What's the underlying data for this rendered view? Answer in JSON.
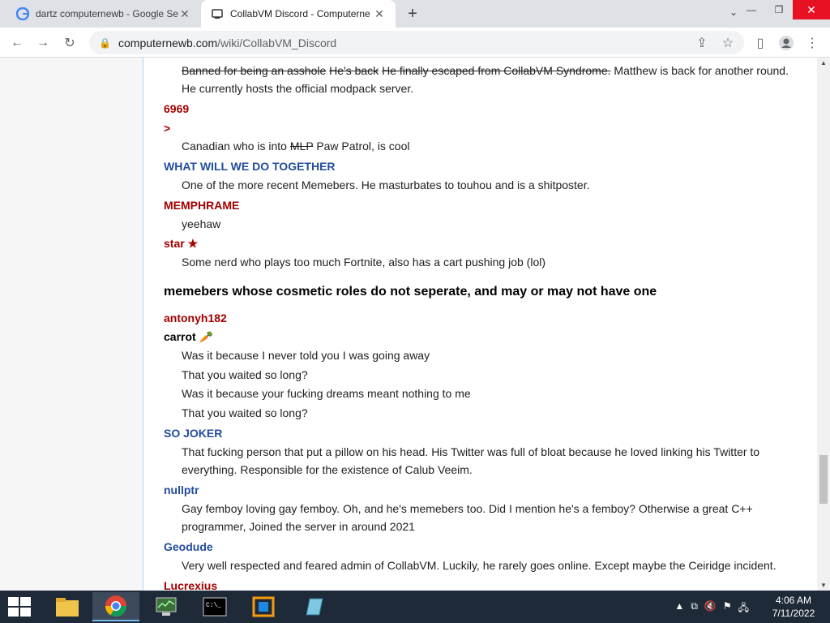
{
  "browser": {
    "tabs": [
      {
        "title": "dartz computernewb - Google Se",
        "favicon": "google-g-icon"
      },
      {
        "title": "CollabVM Discord - Computerne",
        "favicon": "computernewb-icon"
      }
    ],
    "url_host": "computernewb.com",
    "url_path": "/wiki/CollabVM_Discord"
  },
  "page": {
    "top_strike_1": "Banned for being an asshole",
    "top_strike_2": "He's back",
    "top_strike_3": "He finally escaped from CollabVM Syndrome.",
    "top_normal": "Matthew is back for another round.",
    "top_line2": "He currently hosts the official modpack server.",
    "n_6969": "6969",
    "n_gt": ">",
    "canadian_a": "Canadian who is into",
    "canadian_strike": "MLP",
    "canadian_b": "Paw Patrol, is cool",
    "n_together": "WHAT WILL WE DO TOGETHER",
    "t_together": "One of the more recent Memebers. He masturbates to touhou and is a shitposter.",
    "n_memphrame": "MEMPHRAME",
    "t_memphrame": "yeehaw",
    "n_star": "star ★",
    "t_star": "Some nerd who plays too much Fortnite, also has a cart pushing job (lol)",
    "section_heading": "memebers whose cosmetic roles do not seperate, and may or may not have one",
    "n_antonyh": "antonyh182",
    "n_carrot": "carrot 🥕",
    "carrot_lines": [
      "Was it because I never told you I was going away",
      "That you waited so long?",
      "Was it because your fucking dreams meant nothing to me",
      "That you waited so long?"
    ],
    "n_sojoker": "SO JOKER",
    "t_sojoker_1": "That fucking person that put a pillow on his head. His Twitter was full of bloat because he loved linking his Twitter to",
    "t_sojoker_2": "everything. Responsible for the existence of Calub Veeim.",
    "n_nullptr": "nullptr",
    "t_nullptr_1": "Gay femboy loving gay femboy. Oh, and he's memebers too. Did I mention he's a femboy? Otherwise a great C++",
    "t_nullptr_2": "programmer, Joined the server in around 2021",
    "n_geodude": "Geodude",
    "t_geodude": "Very well respected and feared admin of CollabVM. Luckily, he rarely goes online. Except maybe the Ceiridge incident.",
    "n_lucrexius": "Lucrexius"
  },
  "taskbar": {
    "time": "4:06 AM",
    "date": "7/11/2022"
  }
}
